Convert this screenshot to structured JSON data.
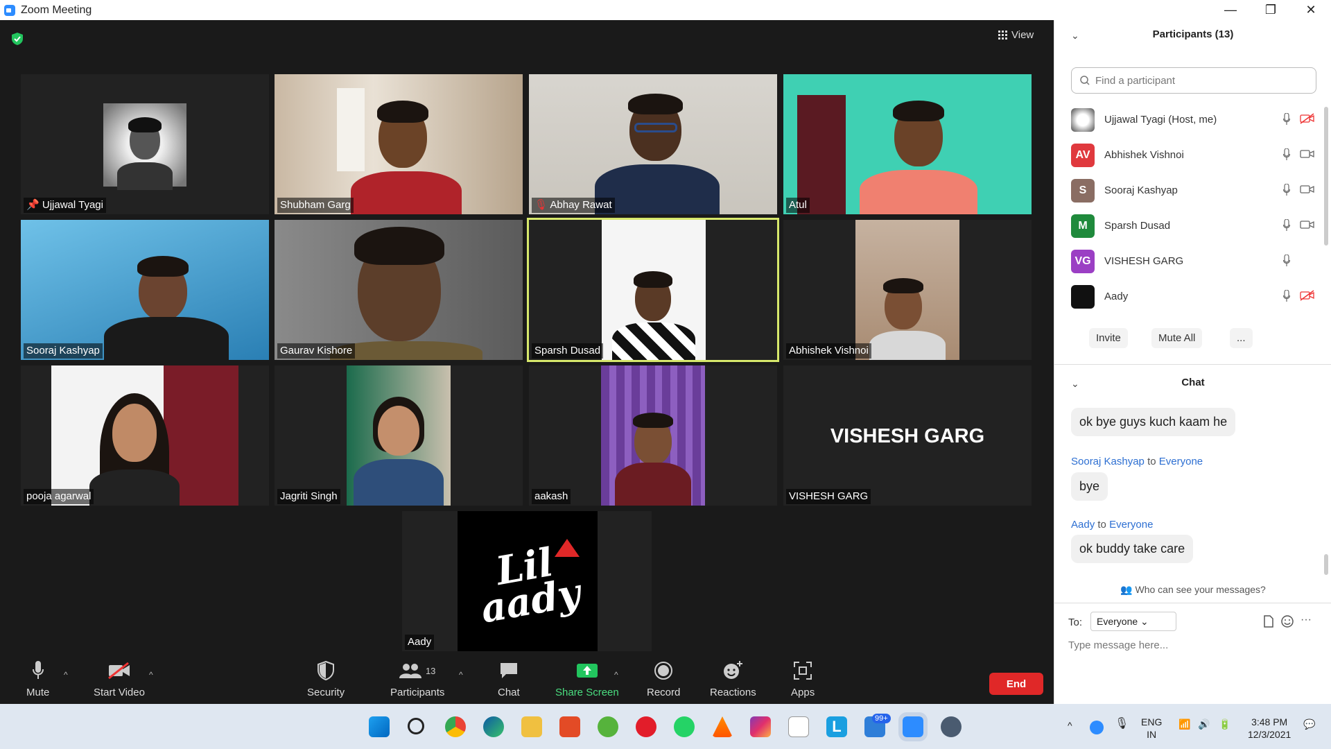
{
  "window": {
    "title": "Zoom Meeting",
    "minimize": "—",
    "restore": "❐",
    "close": "✕"
  },
  "top": {
    "view_label": "View"
  },
  "tiles": [
    {
      "name": "Ujjawal Tyagi",
      "pinned": true
    },
    {
      "name": "Shubham Garg"
    },
    {
      "name": "Abhay Rawat",
      "muted": true
    },
    {
      "name": "Atul"
    },
    {
      "name": "Sooraj Kashyap"
    },
    {
      "name": "Gaurav Kishore"
    },
    {
      "name": "Sparsh Dusad",
      "active_speaker": true
    },
    {
      "name": "Abhishek Vishnoi"
    },
    {
      "name": "pooja agarwal"
    },
    {
      "name": "Jagriti Singh"
    },
    {
      "name": "aakash"
    },
    {
      "name": "VISHESH GARG",
      "display_text": "VISHESH GARG"
    },
    {
      "name": "Aady",
      "logo_text": "Lil aady"
    }
  ],
  "controls": {
    "mute": "Mute",
    "start_video": "Start Video",
    "security": "Security",
    "participants": "Participants",
    "participants_count": "13",
    "chat": "Chat",
    "share_screen": "Share Screen",
    "record": "Record",
    "reactions": "Reactions",
    "apps": "Apps",
    "end": "End"
  },
  "participants_panel": {
    "title": "Participants (13)",
    "search_placeholder": "Find a participant",
    "list": [
      {
        "name": "Ujjawal Tyagi (Host, me)",
        "initials": "",
        "color": "#d9d9d9",
        "video_off": true
      },
      {
        "name": "Abhishek Vishnoi",
        "initials": "AV",
        "color": "#e0393e"
      },
      {
        "name": "Sooraj Kashyap",
        "initials": "S",
        "color": "#8a6d63"
      },
      {
        "name": "Sparsh Dusad",
        "initials": "M",
        "color": "#1f8a3c"
      },
      {
        "name": "VISHESH GARG",
        "initials": "VG",
        "color": "#9b3fc4"
      },
      {
        "name": "Aady",
        "initials": "",
        "color": "#111111",
        "video_off": true
      }
    ],
    "invite": "Invite",
    "mute_all": "Mute All",
    "more": "..."
  },
  "chat_panel": {
    "title": "Chat",
    "messages": [
      {
        "text": "ok bye guys kuch kaam he"
      },
      {
        "sender": "Sooraj Kashyap",
        "to": "to",
        "recipient": "Everyone",
        "text": "bye"
      },
      {
        "sender": "Aady",
        "to": "to",
        "recipient": "Everyone",
        "text": "ok buddy take care"
      }
    ],
    "who_can_see": "Who can see your messages?",
    "to_label": "To:",
    "to_value": "Everyone",
    "placeholder": "Type message here..."
  },
  "taskbar": {
    "lang_top": "ENG",
    "lang_bottom": "IN",
    "time": "3:48 PM",
    "date": "12/3/2021",
    "badge": "99+"
  },
  "colors": {
    "accent": "#2d8cff",
    "end": "#e02828",
    "speaker_border": "#d7e86b",
    "share_green": "#22c55e"
  }
}
